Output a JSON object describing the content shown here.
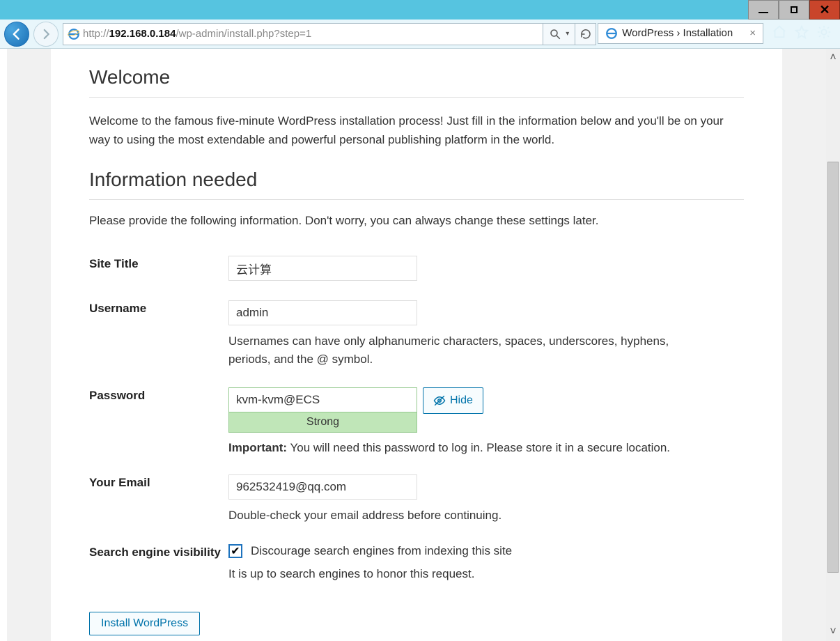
{
  "window": {
    "min": "–",
    "max": "□",
    "close": "✕"
  },
  "browser": {
    "url_prefix": "http://",
    "url_host": "192.168.0.184",
    "url_path": "/wp-admin/install.php?step=1",
    "tab_title": "WordPress › Installation"
  },
  "page": {
    "welcome_heading": "Welcome",
    "welcome_text": "Welcome to the famous five-minute WordPress installation process! Just fill in the information below and you'll be on your way to using the most extendable and powerful personal publishing platform in the world.",
    "info_heading": "Information needed",
    "info_text": "Please provide the following information. Don't worry, you can always change these settings later.",
    "labels": {
      "site_title": "Site Title",
      "username": "Username",
      "password": "Password",
      "email": "Your Email",
      "search_vis": "Search engine visibility"
    },
    "values": {
      "site_title": "云计算",
      "username": "admin",
      "password": "kvm-kvm@ECS",
      "email": "962532419@qq.com"
    },
    "username_hint": "Usernames can have only alphanumeric characters, spaces, underscores, hyphens, periods, and the @ symbol.",
    "hide_label": "Hide",
    "strength_label": "Strong",
    "important_prefix": "Important:",
    "important_text": " You will need this password to log in. Please store it in a secure location.",
    "email_hint": "Double-check your email address before continuing.",
    "search_checkbox_label": "Discourage search engines from indexing this site",
    "search_hint": "It is up to search engines to honor this request.",
    "install_label": "Install WordPress"
  }
}
